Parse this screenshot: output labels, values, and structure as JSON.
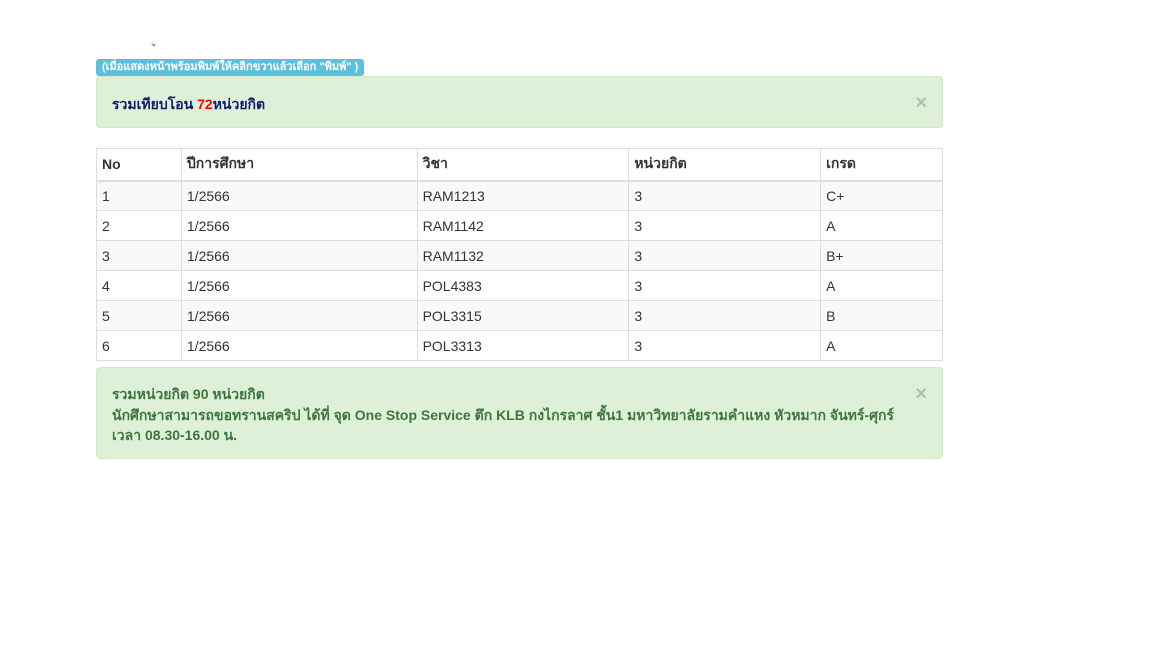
{
  "top_cut_text": "ู",
  "print_hint": "(เมื่อแสดงหน้าพร้อมพิมพ์ให้คลิกขวาแล้วเลือก \"พิมพ์\" )",
  "transfer_summary": {
    "prefix": "รวมเทียบโอน ",
    "credits": "72",
    "suffix": "หน่วยกิต",
    "close_label": "×"
  },
  "table": {
    "headers": [
      "No",
      "ปีการศึกษา",
      "วิชา",
      "หน่วยกิต",
      "เกรด"
    ],
    "rows": [
      [
        "1",
        "1/2566",
        "RAM1213",
        "3",
        "C+"
      ],
      [
        "2",
        "1/2566",
        "RAM1142",
        "3",
        "A"
      ],
      [
        "3",
        "1/2566",
        "RAM1132",
        "3",
        "B+"
      ],
      [
        "4",
        "1/2566",
        "POL4383",
        "3",
        "A"
      ],
      [
        "5",
        "1/2566",
        "POL3315",
        "3",
        "B"
      ],
      [
        "6",
        "1/2566",
        "POL3313",
        "3",
        "A"
      ]
    ]
  },
  "total_summary": {
    "line1": "รวมหน่วยกิต 90 หน่วยกิต",
    "line2": "นักศึกษาสามารถขอทรานสคริป ได้ที่ จุด One Stop Service ตึก KLB กงไกรลาศ ชั้น1 มหาวิทยาลัยรามคำแหง หัวหมาก จันทร์-ศุกร์ เวลา 08.30-16.00 น.",
    "close_label": "×"
  },
  "colors": {
    "alert_bg": "#dff0d8",
    "alert_text": "#3c763d",
    "label_info": "#5bc0de",
    "credits_highlight": "#ff0000"
  }
}
